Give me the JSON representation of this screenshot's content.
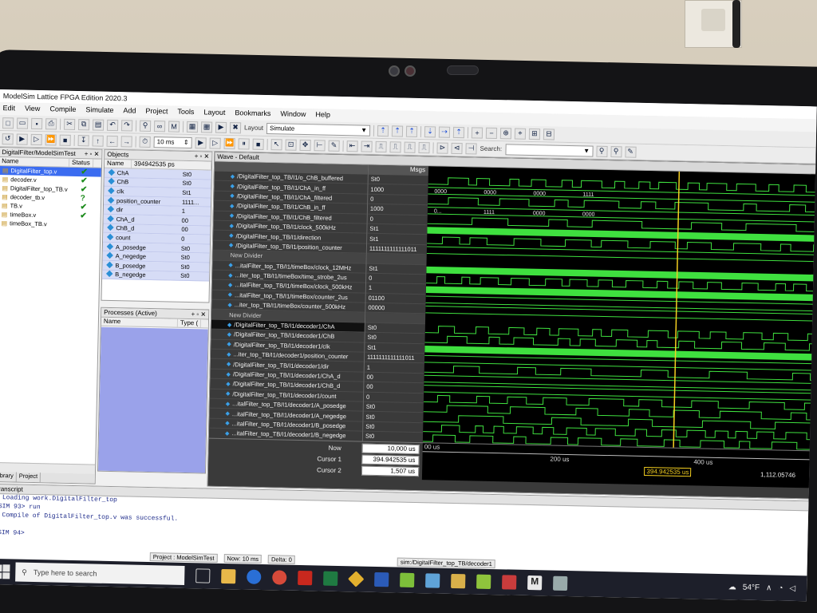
{
  "window": {
    "title": "ModelSim Lattice FPGA Edition 2020.3"
  },
  "menu": [
    "Edit",
    "View",
    "Compile",
    "Simulate",
    "Add",
    "Project",
    "Tools",
    "Layout",
    "Bookmarks",
    "Window",
    "Help"
  ],
  "toolbar": {
    "layout_label": "Layout",
    "layout_value": "Simulate",
    "run_length": "10 ms",
    "search_label": "Search:"
  },
  "library_pane": {
    "title": "DigitalFilter/ModelSimTest",
    "columns": [
      "Name",
      "Status"
    ],
    "items": [
      {
        "name": "DigitalFilter_top.v",
        "status": "✔"
      },
      {
        "name": "decoder.v",
        "status": "✔"
      },
      {
        "name": "DigitalFilter_top_TB.v",
        "status": "✔"
      },
      {
        "name": "decoder_tb.v",
        "status": "?"
      },
      {
        "name": "TB.v",
        "status": "✔"
      },
      {
        "name": "timeBox.v",
        "status": "✔"
      },
      {
        "name": "timeBox_TB.v",
        "status": ""
      }
    ],
    "tabs": [
      "Library",
      "Project"
    ]
  },
  "objects_pane": {
    "title": "Objects",
    "filter_value": "394942535 ps",
    "columns": [
      "Name"
    ],
    "rows": [
      {
        "name": "ChA",
        "value": "St0"
      },
      {
        "name": "ChB",
        "value": "St0"
      },
      {
        "name": "clk",
        "value": "St1"
      },
      {
        "name": "position_counter",
        "value": "1111..."
      },
      {
        "name": "dir",
        "value": "1"
      },
      {
        "name": "ChA_d",
        "value": "00"
      },
      {
        "name": "ChB_d",
        "value": "00"
      },
      {
        "name": "count",
        "value": "0"
      },
      {
        "name": "A_posedge",
        "value": "St0"
      },
      {
        "name": "A_negedge",
        "value": "St0"
      },
      {
        "name": "B_posedge",
        "value": "St0"
      },
      {
        "name": "B_negedge",
        "value": "St0"
      }
    ]
  },
  "processes_pane": {
    "title": "Processes (Active)",
    "columns": [
      "Name",
      "Type ("
    ]
  },
  "wave": {
    "title": "Wave - Default",
    "msgs_header": "Msgs",
    "signals": [
      {
        "name": "/DigitalFilter_top_TB/I1/o_ChB_buffered",
        "value": "St0"
      },
      {
        "name": "/DigitalFilter_top_TB/I1/ChA_in_ff",
        "value": "1000"
      },
      {
        "name": "/DigitalFilter_top_TB/I1/ChA_filtered",
        "value": "0"
      },
      {
        "name": "/DigitalFilter_top_TB/I1/ChB_in_ff",
        "value": "1000"
      },
      {
        "name": "/DigitalFilter_top_TB/I1/ChB_filtered",
        "value": "0"
      },
      {
        "name": "/DigitalFilter_top_TB/I1/clock_500kHz",
        "value": "St1"
      },
      {
        "name": "/DigitalFilter_top_TB/I1/direction",
        "value": "St1"
      },
      {
        "name": "/DigitalFilter_top_TB/I1/position_counter",
        "value": "1111111111111011"
      },
      {
        "name": "New Divider",
        "value": "",
        "divider": true
      },
      {
        "name": "...italFilter_top_TB/I1/timeBox/clock_12MHz",
        "value": "St1"
      },
      {
        "name": "...iter_top_TB/I1/timeBox/time_strobe_2us",
        "value": "0"
      },
      {
        "name": "...italFilter_top_TB/I1/timeBox/clock_500kHz",
        "value": "1"
      },
      {
        "name": "...italFilter_top_TB/I1/timeBox/counter_2us",
        "value": "01100"
      },
      {
        "name": "...iter_top_TB/I1/timeBox/counter_500kHz",
        "value": "00000"
      },
      {
        "name": "New Divider",
        "value": "",
        "divider": true
      },
      {
        "name": "/DigitalFilter_top_TB/I1/decoder1/ChA",
        "value": "St0",
        "selected": true
      },
      {
        "name": "/DigitalFilter_top_TB/I1/decoder1/ChB",
        "value": "St0"
      },
      {
        "name": "/DigitalFilter_top_TB/I1/decoder1/clk",
        "value": "St1"
      },
      {
        "name": "...iter_top_TB/I1/decoder1/position_counter",
        "value": "1111111111111011"
      },
      {
        "name": "/DigitalFilter_top_TB/I1/decoder1/dir",
        "value": "1"
      },
      {
        "name": "/DigitalFilter_top_TB/I1/decoder1/ChA_d",
        "value": "00"
      },
      {
        "name": "/DigitalFilter_top_TB/I1/decoder1/ChB_d",
        "value": "00"
      },
      {
        "name": "/DigitalFilter_top_TB/I1/decoder1/count",
        "value": "0"
      },
      {
        "name": "...italFilter_top_TB/I1/decoder1/A_posedge",
        "value": "St0"
      },
      {
        "name": "...italFilter_top_TB/I1/decoder1/A_negedge",
        "value": "St0"
      },
      {
        "name": "...italFilter_top_TB/I1/decoder1/B_posedge",
        "value": "St0"
      },
      {
        "name": "...italFilter_top_TB/I1/decoder1/B_negedge",
        "value": "St0"
      }
    ],
    "bus_labels": [
      "0000",
      "0000",
      "0000",
      "1111",
      "0...",
      "1111",
      "0000",
      "0000"
    ],
    "now_label": "Now",
    "now_value": "10,000 us",
    "cursor1_label": "Cursor 1",
    "cursor1_value": "394.942535 us",
    "cursor2_label": "Cursor 2",
    "cursor2_value": "1,507 us",
    "time_axis": [
      "00 us",
      "200 us",
      "400 us"
    ],
    "cursor_flag": "394.942535 us",
    "cursor_flag2": "1,112.05746",
    "cursor1_fraction": 0.395
  },
  "transcript": {
    "title": "Transcript",
    "lines": [
      "# Loading work.DigitalFilter_top",
      "VSIM 93> run",
      "# Compile of DigitalFilter_top.v was successful.",
      "",
      "VSIM 94>"
    ]
  },
  "statusbar": {
    "project": "Project : ModelSimTest",
    "now": "Now: 10 ms",
    "delta": "Delta: 0",
    "sim": "sim:/DigitalFilter_top_TB/decoder1"
  },
  "taskbar": {
    "search_placeholder": "Type here to search",
    "weather": "54°F"
  }
}
